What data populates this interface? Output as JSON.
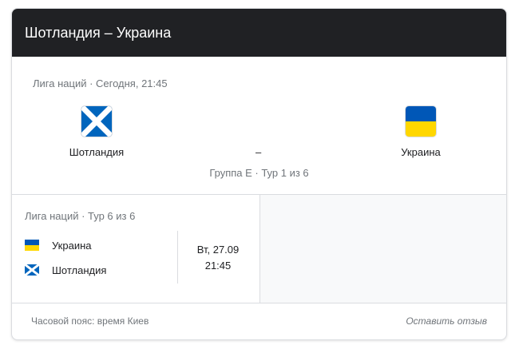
{
  "header": {
    "title": "Шотландия – Украина"
  },
  "match": {
    "meta": "Лига наций · Сегодня, 21:45",
    "home_team": "Шотландия",
    "away_team": "Украина",
    "score": "–",
    "group_round": "Группа E · Тур 1 из 6"
  },
  "next_match": {
    "meta": "Лига наций · Тур 6 из 6",
    "team1": "Украина",
    "team2": "Шотландия",
    "date": "Вт, 27.09",
    "time": "21:45"
  },
  "footer": {
    "timezone": "Часовой пояс: время Киев",
    "feedback": "Оставить отзыв"
  },
  "colors": {
    "header_bg": "#202124",
    "scotland_blue": "#0065BD",
    "ukraine_blue": "#0057B7",
    "ukraine_yellow": "#FFD700"
  }
}
